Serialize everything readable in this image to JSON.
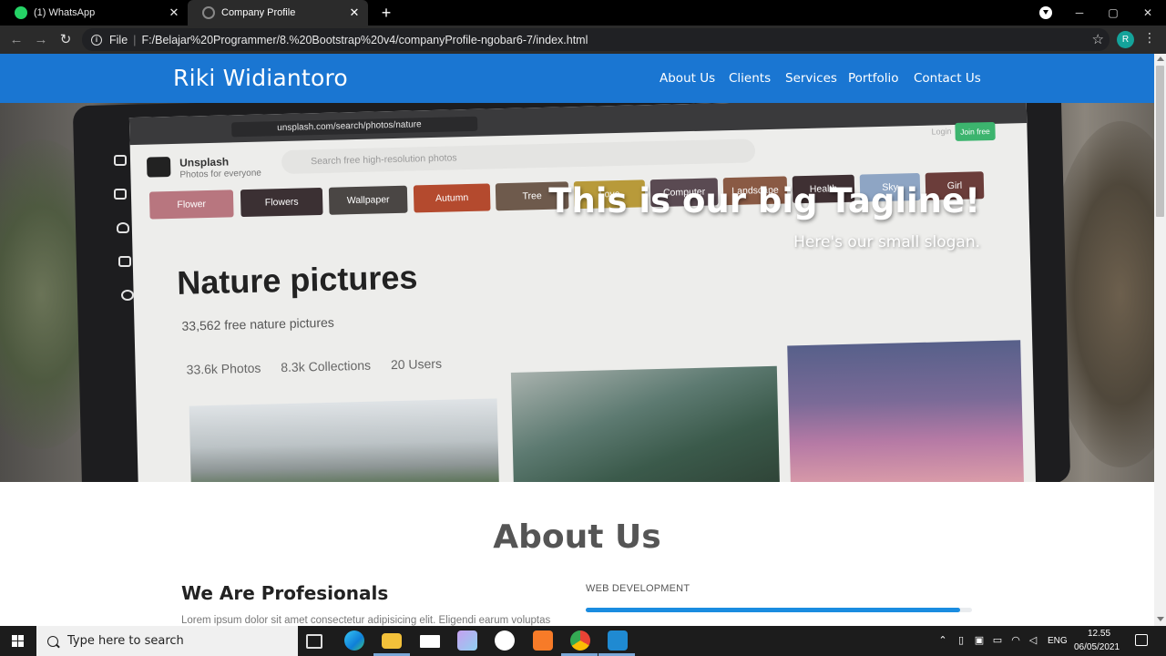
{
  "browser": {
    "tabs": [
      {
        "label": "(1) WhatsApp",
        "icon": "whatsapp-icon"
      },
      {
        "label": "Company Profile",
        "icon": "globe-icon",
        "active": true
      }
    ],
    "address": {
      "scheme": "File",
      "url": "F:/Belajar%20Programmer/8.%20Bootstrap%20v4/companyProfile-ngobar6-7/index.html"
    },
    "profile_initial": "R"
  },
  "site": {
    "brand": "Riki Widiantoro",
    "nav": [
      "About Us",
      "Clients",
      "Services",
      "Portfolio",
      "Contact Us"
    ],
    "hero": {
      "tagline": "This is our big Tagline!",
      "slogan": "Here's our small slogan."
    },
    "hero_photo": {
      "url": "unsplash.com/search/photos/nature",
      "brand": "Unsplash",
      "brand_sub": "Photos for everyone",
      "search_placeholder": "Search free high-resolution photos",
      "login": "Login",
      "join": "Join free",
      "chips": [
        "Flower",
        "Flowers",
        "Wallpaper",
        "Autumn",
        "Tree",
        "Love",
        "Computer",
        "Landscape",
        "Health",
        "Sky",
        "Girl"
      ],
      "heading": "Nature pictures",
      "count": "33,562 free nature pictures",
      "tabs": [
        "33.6k Photos",
        "8.3k Collections",
        "20 Users"
      ]
    },
    "about": {
      "title": "About Us",
      "subtitle": "We Are Profesionals",
      "text": "Lorem ipsum dolor sit amet consectetur adipisicing elit. Eligendi earum voluptas",
      "skill_label": "WEB DEVELOPMENT",
      "skill_progress": 0.97
    }
  },
  "taskbar": {
    "search_placeholder": "Type here to search",
    "apps": [
      "task-view",
      "edge",
      "file-explorer",
      "mail",
      "paint",
      "word",
      "xampp",
      "chrome",
      "vscode"
    ],
    "lang": "ENG",
    "time": "12.55",
    "date": "06/05/2021",
    "notification_count": "1"
  },
  "colors": {
    "navbar": "#1a76d2",
    "progress": "#1a8ce0",
    "whatsapp": "#25d366"
  }
}
